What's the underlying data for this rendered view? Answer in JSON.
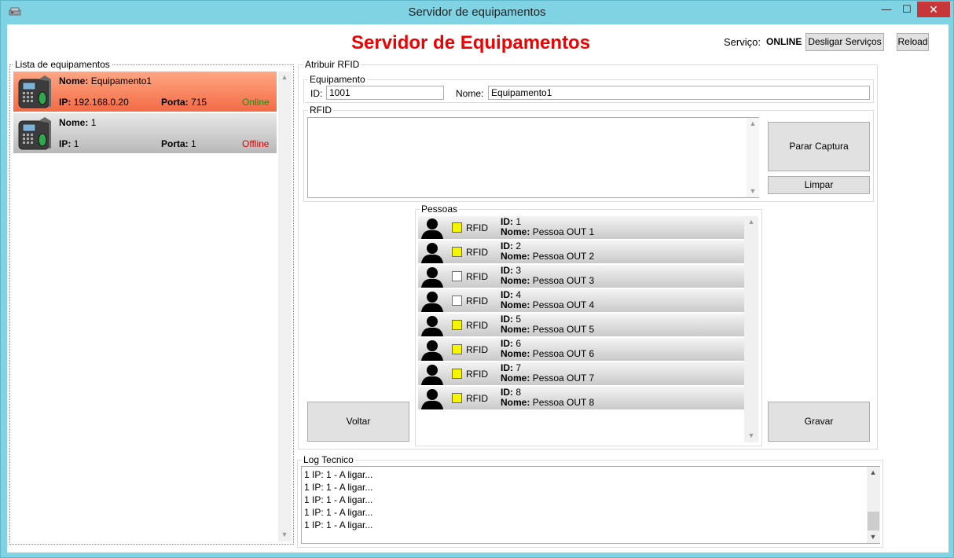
{
  "window": {
    "title": "Servidor de equipamentos",
    "minimize": "—",
    "maximize": "☐",
    "close": "✕"
  },
  "header": {
    "title": "Servidor de Equipamentos",
    "service_label": "Serviço:",
    "service_status": "ONLINE",
    "desligar_button": "Desligar Serviços",
    "reload_button": "Reload"
  },
  "equipment_list": {
    "legend": "Lista de equipamentos",
    "items": [
      {
        "name_label": "Nome:",
        "name": "Equipamento1",
        "ip_label": "IP:",
        "ip": "192.168.0.20",
        "port_label": "Porta:",
        "port": "715",
        "status": "Online"
      },
      {
        "name_label": "Nome:",
        "name": "1",
        "ip_label": "IP:",
        "ip": "1",
        "port_label": "Porta:",
        "port": "1",
        "status": "Offline"
      }
    ]
  },
  "rfid_assign": {
    "legend": "Atribuir RFID",
    "equipment": {
      "legend": "Equipamento",
      "id_label": "ID:",
      "id_value": "1001",
      "name_label": "Nome:",
      "name_value": "Equipamento1"
    },
    "rfid": {
      "legend": "RFID",
      "parar_button": "Parar Captura",
      "limpar_button": "Limpar"
    },
    "pessoas": {
      "legend": "Pessoas",
      "rows": [
        {
          "checkbox_label": "RFID",
          "checked": true,
          "id_label": "ID:",
          "id": "1",
          "name_label": "Nome:",
          "name": "Pessoa OUT 1"
        },
        {
          "checkbox_label": "RFID",
          "checked": true,
          "id_label": "ID:",
          "id": "2",
          "name_label": "Nome:",
          "name": "Pessoa OUT 2"
        },
        {
          "checkbox_label": "RFID",
          "checked": false,
          "id_label": "ID:",
          "id": "3",
          "name_label": "Nome:",
          "name": "Pessoa OUT 3"
        },
        {
          "checkbox_label": "RFID",
          "checked": false,
          "id_label": "ID:",
          "id": "4",
          "name_label": "Nome:",
          "name": "Pessoa OUT 4"
        },
        {
          "checkbox_label": "RFID",
          "checked": true,
          "id_label": "ID:",
          "id": "5",
          "name_label": "Nome:",
          "name": "Pessoa OUT 5"
        },
        {
          "checkbox_label": "RFID",
          "checked": true,
          "id_label": "ID:",
          "id": "6",
          "name_label": "Nome:",
          "name": "Pessoa OUT 6"
        },
        {
          "checkbox_label": "RFID",
          "checked": true,
          "id_label": "ID:",
          "id": "7",
          "name_label": "Nome:",
          "name": "Pessoa OUT 7"
        },
        {
          "checkbox_label": "RFID",
          "checked": true,
          "id_label": "ID:",
          "id": "8",
          "name_label": "Nome:",
          "name": "Pessoa OUT 8"
        }
      ]
    },
    "voltar_button": "Voltar",
    "gravar_button": "Gravar"
  },
  "log": {
    "legend": "Log Tecnico",
    "lines": [
      "1 IP: 1 - A ligar...",
      "1 IP: 1 - A ligar...",
      "1 IP: 1 - A ligar...",
      "1 IP: 1 - A ligar...",
      "1 IP: 1 - A ligar..."
    ]
  },
  "icons": {
    "app": "server-app-icon",
    "device": "biometric-terminal-icon",
    "person": "person-silhouette-icon",
    "scroll_up": "▲",
    "scroll_down": "▼"
  },
  "colors": {
    "title_red": "#ee0000",
    "online_green": "#1a8c1a",
    "offline_red": "#e00000",
    "checked_yellow": "#f5f500",
    "selected_item": "#f26b45"
  }
}
